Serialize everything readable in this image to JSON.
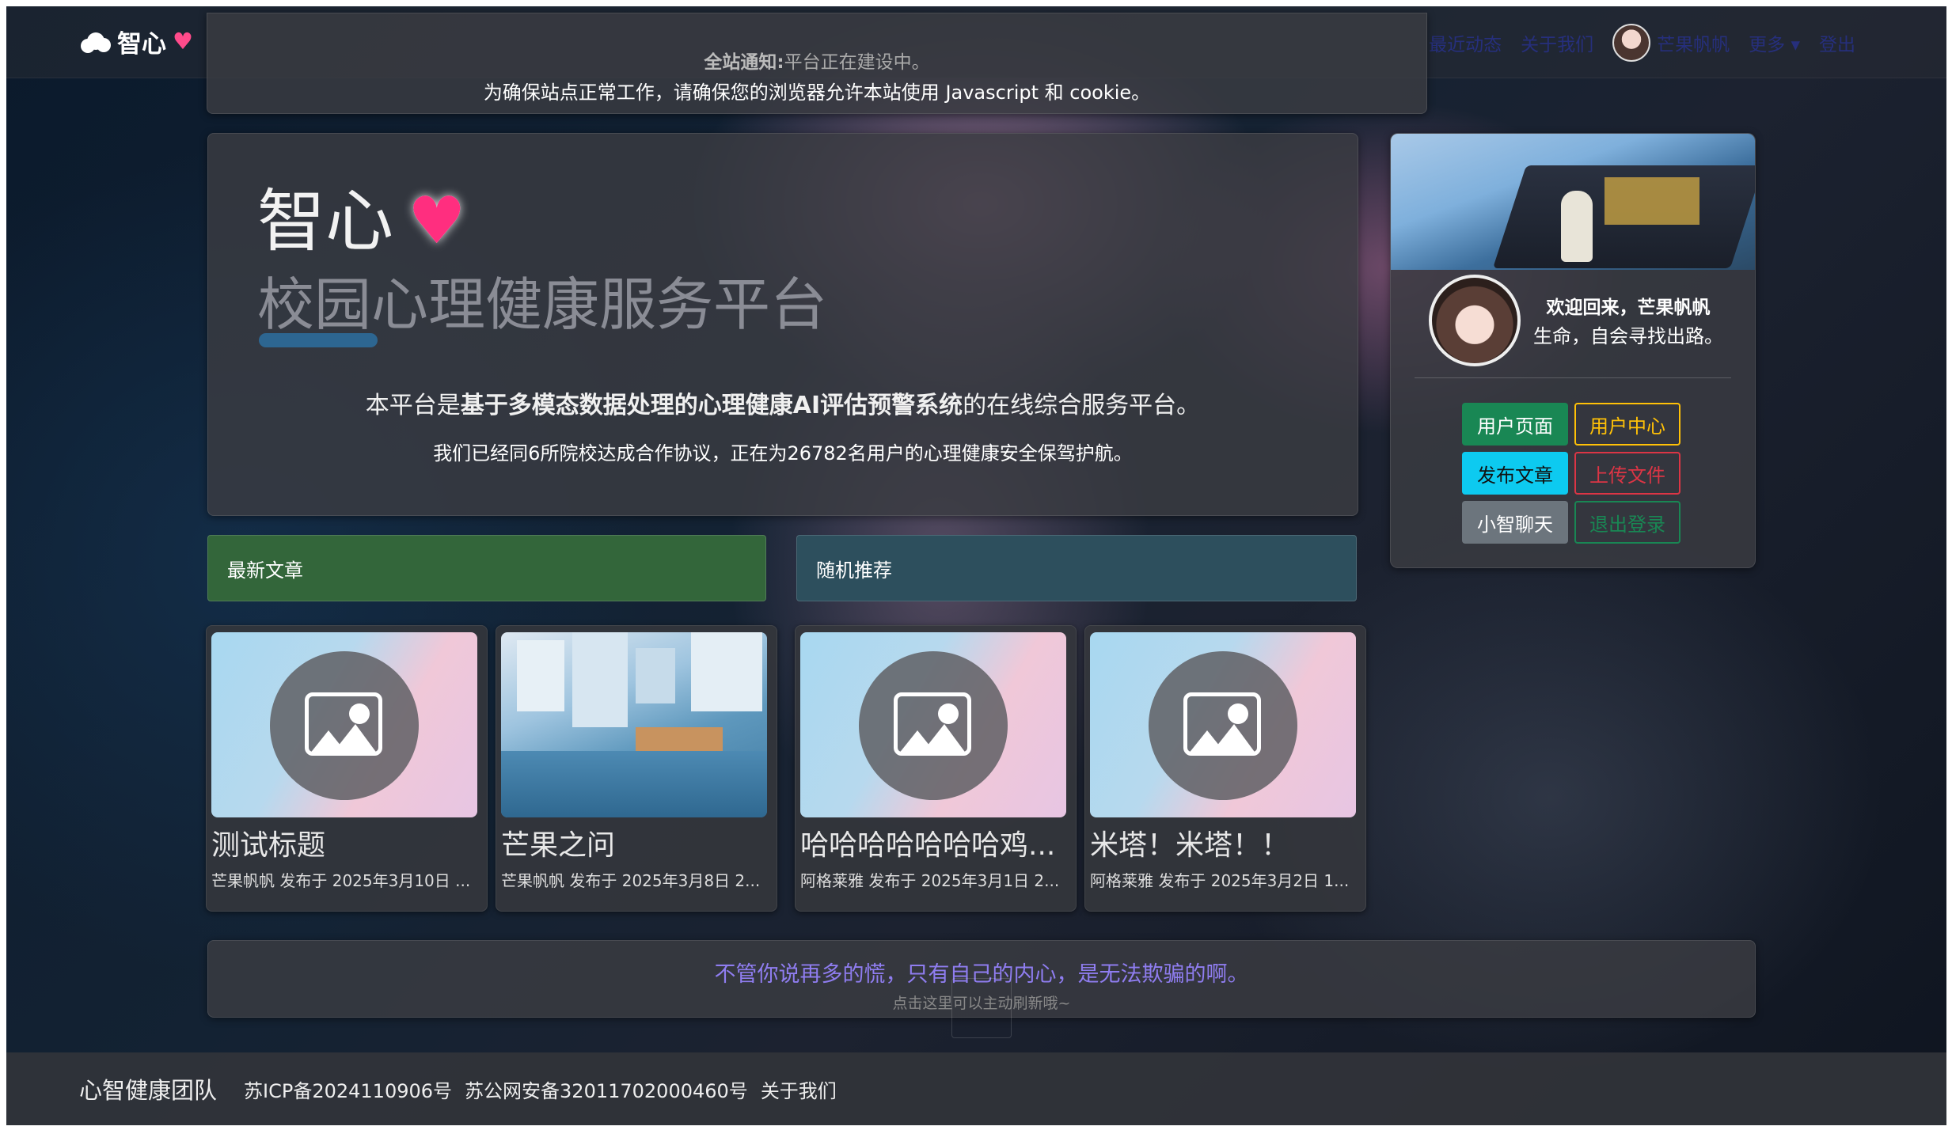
{
  "navbar": {
    "brand": "智心",
    "links": [
      "最近动态",
      "关于我们"
    ],
    "username": "芒果帆帆",
    "more": "更多 ▾",
    "logout": "登出"
  },
  "notice": {
    "label": "全站通知:",
    "text": "平台正在建设中。",
    "line2": "为确保站点正常工作，请确保您的浏览器允许本站使用 Javascript 和 cookie。"
  },
  "hero": {
    "title": "智心",
    "subtitle": "校园心理健康服务平台",
    "desc_prefix": "本平台是",
    "desc_bold": "基于多模态数据处理的心理健康AI评估预警系统",
    "desc_suffix": "的在线综合服务平台。",
    "stats": "我们已经同6所院校达成合作协议，正在为26782名用户的心理健康安全保驾护航。"
  },
  "profile": {
    "welcome": "欢迎回来，芒果帆帆",
    "motto": "生命，自会寻找出路。",
    "buttons": {
      "user_page": "用户页面",
      "user_center": "用户中心",
      "post_article": "发布文章",
      "upload_file": "上传文件",
      "chat": "小智聊天",
      "logout": "退出登录"
    }
  },
  "tabs": {
    "latest": "最新文章",
    "random": "随机推荐"
  },
  "articles": [
    {
      "title": "测试标题",
      "meta": "芒果帆帆 发布于 2025年3月10日 ...",
      "thumb": "placeholder"
    },
    {
      "title": "芒果之问",
      "meta": "芒果帆帆 发布于 2025年3月8日 2...",
      "thumb": "minecraft-water"
    },
    {
      "title": "哈哈哈哈哈哈哈鸡...",
      "meta": "阿格莱雅 发布于 2025年3月1日 2...",
      "thumb": "placeholder"
    },
    {
      "title": "米塔！米塔！！",
      "meta": "阿格莱雅 发布于 2025年3月2日 1...",
      "thumb": "placeholder"
    }
  ],
  "quote": {
    "text": "不管你说再多的慌，只有自己的内心，是无法欺骗的啊。",
    "hint": "点击这里可以主动刷新哦~"
  },
  "footer": {
    "team": "心智健康团队",
    "icp": "苏ICP备2024110906号",
    "police": "苏公网安备32011702000460号",
    "about": "关于我们"
  },
  "colors": {
    "latest_tab": "#33663a",
    "random_tab": "#2d4f5d",
    "quote": "#8f7df0",
    "heart": "#ff2e7f"
  }
}
